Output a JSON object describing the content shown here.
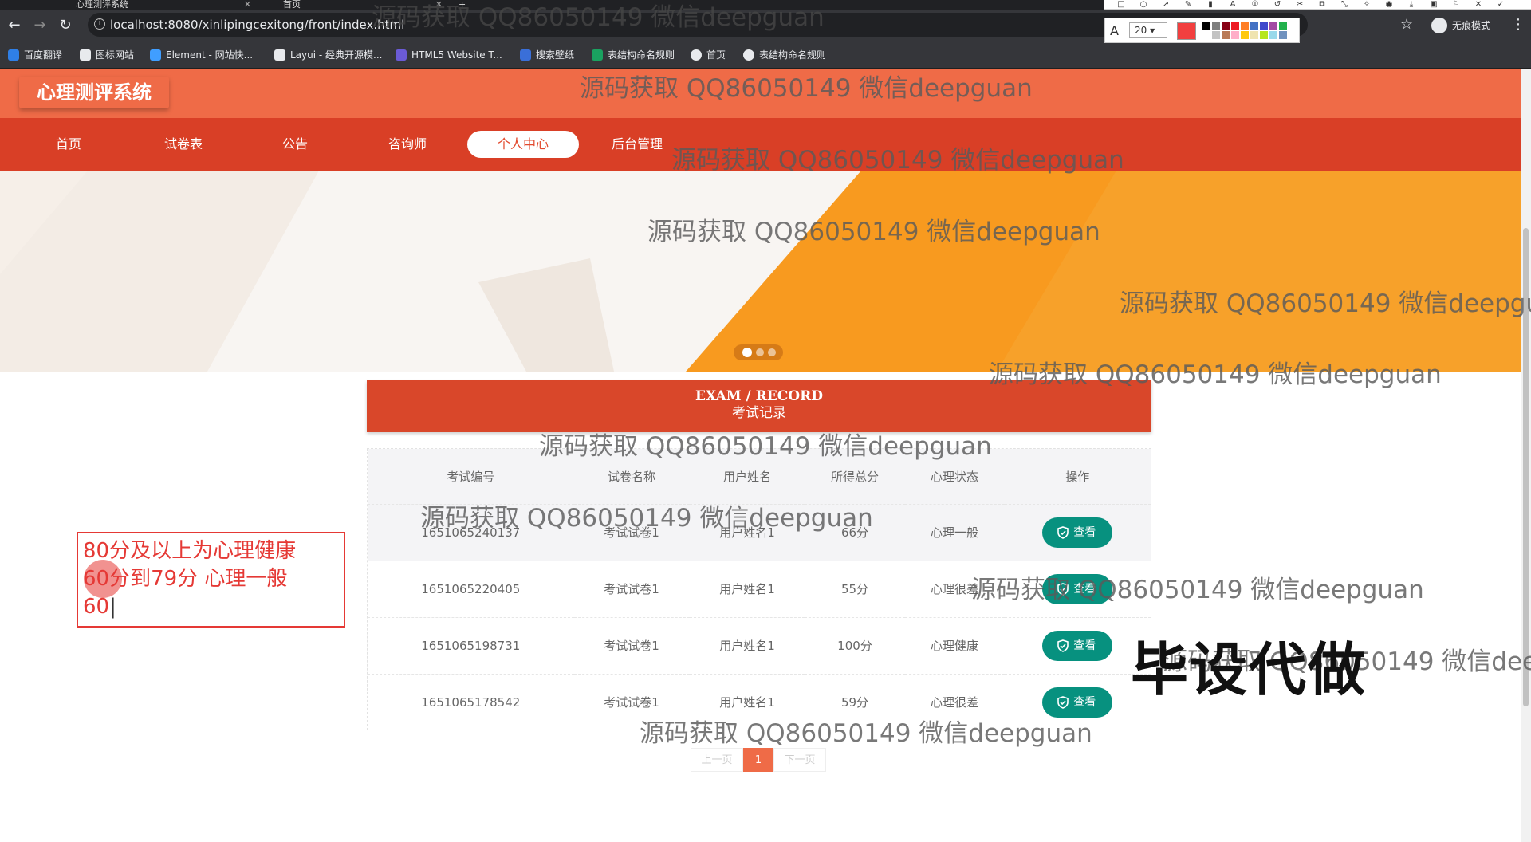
{
  "browser": {
    "tabs": [
      {
        "title": "心理测评系统"
      },
      {
        "title": "首页"
      }
    ],
    "url": "localhost:8080/xinlipingcexitong/front/index.html",
    "incognito_label": "无痕模式",
    "bookmarks": [
      {
        "label": "百度翻译",
        "color": "#2f7fe6"
      },
      {
        "label": "图标网站",
        "color": "#e8eaed"
      },
      {
        "label": "Element - 网站快...",
        "color": "#409eff"
      },
      {
        "label": "Layui - 经典开源模...",
        "color": "#e8eaed"
      },
      {
        "label": "HTML5 Website T...",
        "color": "#6b5bd6"
      },
      {
        "label": "搜索壁纸",
        "color": "#3a6fd8"
      },
      {
        "label": "表结构命名规则",
        "color": "#1aa260"
      },
      {
        "label": "首页",
        "color": "#e8eaed"
      },
      {
        "label": "表结构命名规则",
        "color": "#e8eaed"
      }
    ]
  },
  "annotation_tool": {
    "font_size": "20",
    "current_color": "#f23f3f",
    "palette": [
      "#000000",
      "#7f7f7f",
      "#880015",
      "#ed1c24",
      "#ff7f27",
      "#4472c4",
      "#3f48cc",
      "#a349a4",
      "#22b14c",
      "#ffffff",
      "#c3c3c3",
      "#b97a57",
      "#ffaec9",
      "#ffc90e",
      "#efe4b0",
      "#b5e61d",
      "#99d9ea",
      "#7092be"
    ]
  },
  "site": {
    "logo": "心理测评系统",
    "nav": [
      {
        "label": "首页",
        "active": false
      },
      {
        "label": "试卷表",
        "active": false
      },
      {
        "label": "公告",
        "active": false
      },
      {
        "label": "咨询师",
        "active": false
      },
      {
        "label": "个人中心",
        "active": true
      },
      {
        "label": "后台管理",
        "active": false
      }
    ],
    "colors": {
      "header": "#ef6b47",
      "nav": "#d93f26",
      "accent": "#07917f"
    }
  },
  "section": {
    "title_en": "EXAM / RECORD",
    "title_cn": "考试记录"
  },
  "table": {
    "headers": [
      "考试编号",
      "试卷名称",
      "用户姓名",
      "所得总分",
      "心理状态",
      "操作"
    ],
    "rows": [
      {
        "id": "1651065240137",
        "paper": "考试试卷1",
        "user": "用户姓名1",
        "score": "66分",
        "state": "心理一般",
        "action": "查看"
      },
      {
        "id": "1651065220405",
        "paper": "考试试卷1",
        "user": "用户姓名1",
        "score": "55分",
        "state": "心理很差",
        "action": "查看"
      },
      {
        "id": "1651065198731",
        "paper": "考试试卷1",
        "user": "用户姓名1",
        "score": "100分",
        "state": "心理健康",
        "action": "查看"
      },
      {
        "id": "1651065178542",
        "paper": "考试试卷1",
        "user": "用户姓名1",
        "score": "59分",
        "state": "心理很差",
        "action": "查看"
      }
    ]
  },
  "pager": {
    "prev": "上一页",
    "current": "1",
    "next": "下一页"
  },
  "note": {
    "lines": [
      "80分及以上为心理健康",
      "60分到79分 心理一般",
      "60"
    ]
  },
  "watermark": {
    "text": "源码获取 QQ86050149 微信deepguan",
    "stamp": "毕设代做"
  }
}
